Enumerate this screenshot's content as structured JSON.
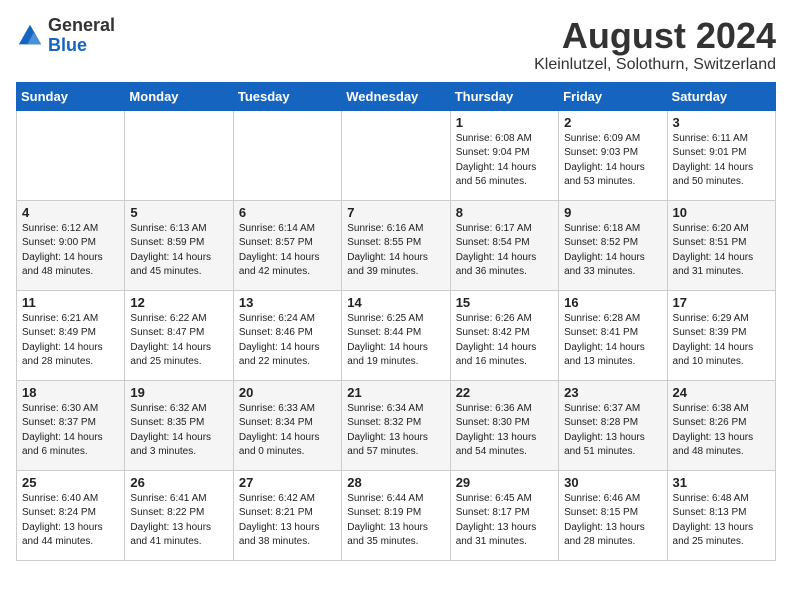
{
  "logo": {
    "general": "General",
    "blue": "Blue"
  },
  "title": "August 2024",
  "location": "Kleinlutzel, Solothurn, Switzerland",
  "days_header": [
    "Sunday",
    "Monday",
    "Tuesday",
    "Wednesday",
    "Thursday",
    "Friday",
    "Saturday"
  ],
  "weeks": [
    [
      {
        "day": "",
        "info": ""
      },
      {
        "day": "",
        "info": ""
      },
      {
        "day": "",
        "info": ""
      },
      {
        "day": "",
        "info": ""
      },
      {
        "day": "1",
        "info": "Sunrise: 6:08 AM\nSunset: 9:04 PM\nDaylight: 14 hours\nand 56 minutes."
      },
      {
        "day": "2",
        "info": "Sunrise: 6:09 AM\nSunset: 9:03 PM\nDaylight: 14 hours\nand 53 minutes."
      },
      {
        "day": "3",
        "info": "Sunrise: 6:11 AM\nSunset: 9:01 PM\nDaylight: 14 hours\nand 50 minutes."
      }
    ],
    [
      {
        "day": "4",
        "info": "Sunrise: 6:12 AM\nSunset: 9:00 PM\nDaylight: 14 hours\nand 48 minutes."
      },
      {
        "day": "5",
        "info": "Sunrise: 6:13 AM\nSunset: 8:59 PM\nDaylight: 14 hours\nand 45 minutes."
      },
      {
        "day": "6",
        "info": "Sunrise: 6:14 AM\nSunset: 8:57 PM\nDaylight: 14 hours\nand 42 minutes."
      },
      {
        "day": "7",
        "info": "Sunrise: 6:16 AM\nSunset: 8:55 PM\nDaylight: 14 hours\nand 39 minutes."
      },
      {
        "day": "8",
        "info": "Sunrise: 6:17 AM\nSunset: 8:54 PM\nDaylight: 14 hours\nand 36 minutes."
      },
      {
        "day": "9",
        "info": "Sunrise: 6:18 AM\nSunset: 8:52 PM\nDaylight: 14 hours\nand 33 minutes."
      },
      {
        "day": "10",
        "info": "Sunrise: 6:20 AM\nSunset: 8:51 PM\nDaylight: 14 hours\nand 31 minutes."
      }
    ],
    [
      {
        "day": "11",
        "info": "Sunrise: 6:21 AM\nSunset: 8:49 PM\nDaylight: 14 hours\nand 28 minutes."
      },
      {
        "day": "12",
        "info": "Sunrise: 6:22 AM\nSunset: 8:47 PM\nDaylight: 14 hours\nand 25 minutes."
      },
      {
        "day": "13",
        "info": "Sunrise: 6:24 AM\nSunset: 8:46 PM\nDaylight: 14 hours\nand 22 minutes."
      },
      {
        "day": "14",
        "info": "Sunrise: 6:25 AM\nSunset: 8:44 PM\nDaylight: 14 hours\nand 19 minutes."
      },
      {
        "day": "15",
        "info": "Sunrise: 6:26 AM\nSunset: 8:42 PM\nDaylight: 14 hours\nand 16 minutes."
      },
      {
        "day": "16",
        "info": "Sunrise: 6:28 AM\nSunset: 8:41 PM\nDaylight: 14 hours\nand 13 minutes."
      },
      {
        "day": "17",
        "info": "Sunrise: 6:29 AM\nSunset: 8:39 PM\nDaylight: 14 hours\nand 10 minutes."
      }
    ],
    [
      {
        "day": "18",
        "info": "Sunrise: 6:30 AM\nSunset: 8:37 PM\nDaylight: 14 hours\nand 6 minutes."
      },
      {
        "day": "19",
        "info": "Sunrise: 6:32 AM\nSunset: 8:35 PM\nDaylight: 14 hours\nand 3 minutes."
      },
      {
        "day": "20",
        "info": "Sunrise: 6:33 AM\nSunset: 8:34 PM\nDaylight: 14 hours\nand 0 minutes."
      },
      {
        "day": "21",
        "info": "Sunrise: 6:34 AM\nSunset: 8:32 PM\nDaylight: 13 hours\nand 57 minutes."
      },
      {
        "day": "22",
        "info": "Sunrise: 6:36 AM\nSunset: 8:30 PM\nDaylight: 13 hours\nand 54 minutes."
      },
      {
        "day": "23",
        "info": "Sunrise: 6:37 AM\nSunset: 8:28 PM\nDaylight: 13 hours\nand 51 minutes."
      },
      {
        "day": "24",
        "info": "Sunrise: 6:38 AM\nSunset: 8:26 PM\nDaylight: 13 hours\nand 48 minutes."
      }
    ],
    [
      {
        "day": "25",
        "info": "Sunrise: 6:40 AM\nSunset: 8:24 PM\nDaylight: 13 hours\nand 44 minutes."
      },
      {
        "day": "26",
        "info": "Sunrise: 6:41 AM\nSunset: 8:22 PM\nDaylight: 13 hours\nand 41 minutes."
      },
      {
        "day": "27",
        "info": "Sunrise: 6:42 AM\nSunset: 8:21 PM\nDaylight: 13 hours\nand 38 minutes."
      },
      {
        "day": "28",
        "info": "Sunrise: 6:44 AM\nSunset: 8:19 PM\nDaylight: 13 hours\nand 35 minutes."
      },
      {
        "day": "29",
        "info": "Sunrise: 6:45 AM\nSunset: 8:17 PM\nDaylight: 13 hours\nand 31 minutes."
      },
      {
        "day": "30",
        "info": "Sunrise: 6:46 AM\nSunset: 8:15 PM\nDaylight: 13 hours\nand 28 minutes."
      },
      {
        "day": "31",
        "info": "Sunrise: 6:48 AM\nSunset: 8:13 PM\nDaylight: 13 hours\nand 25 minutes."
      }
    ]
  ]
}
